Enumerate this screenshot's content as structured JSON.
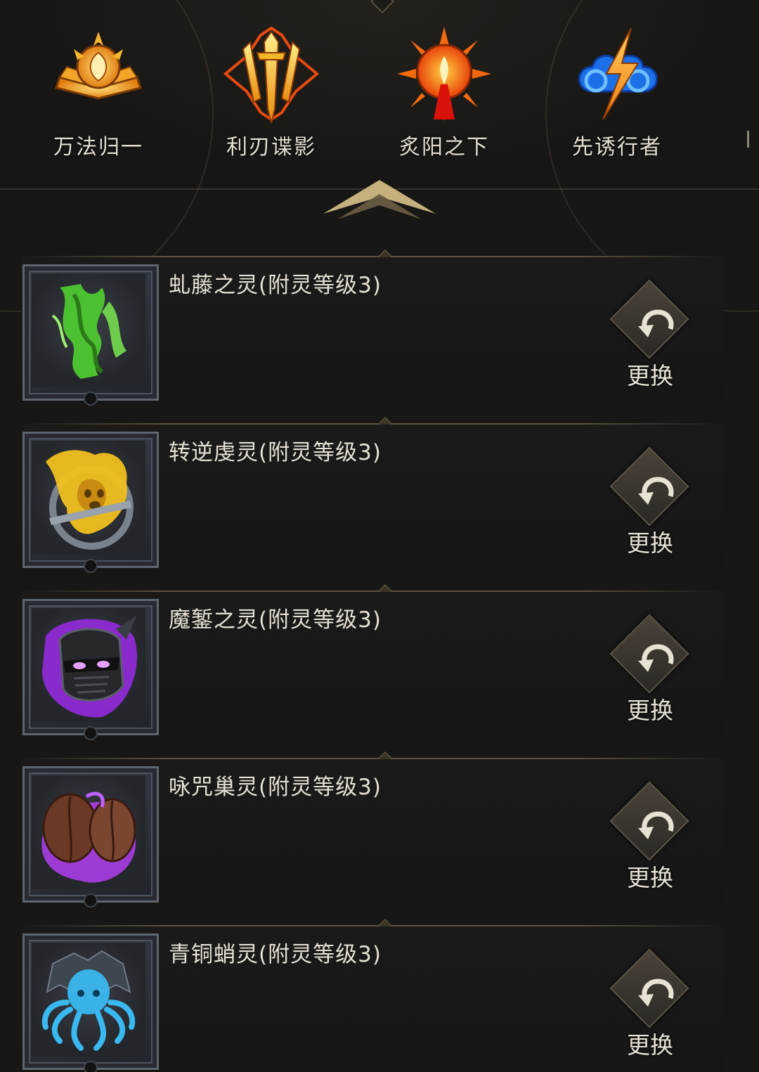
{
  "class_tabs": [
    {
      "label": "万法归一",
      "icon": "arcane-book-emblem-icon",
      "color": "#f0a020"
    },
    {
      "label": "利刃谍影",
      "icon": "golden-blades-emblem-icon",
      "color": "#f3c022"
    },
    {
      "label": "炙阳之下",
      "icon": "burning-sun-emblem-icon",
      "color": "#f06010"
    },
    {
      "label": "先诱行者",
      "icon": "storm-lightning-emblem-icon",
      "color": "#2a7cf0"
    }
  ],
  "spirits": [
    {
      "name": "虬藤之灵(附灵等级3)",
      "icon": "green-vine-spirit-icon",
      "color": "#5ad13a",
      "action_label": "更换"
    },
    {
      "name": "转逆虔灵(附灵等级3)",
      "icon": "golden-ghost-spirit-icon",
      "color": "#e8b820",
      "action_label": "更换"
    },
    {
      "name": "魔錾之灵(附灵等级3)",
      "icon": "dark-helm-spirit-icon",
      "color": "#a030f0",
      "action_label": "更换"
    },
    {
      "name": "咏咒巢灵(附灵等级3)",
      "icon": "cocoon-nest-spirit-icon",
      "color": "#b040f0",
      "action_label": "更换"
    },
    {
      "name": "青铜蛸灵(附灵等级3)",
      "icon": "bronze-octopus-spirit-icon",
      "color": "#2ab0e8",
      "action_label": "更换"
    }
  ]
}
